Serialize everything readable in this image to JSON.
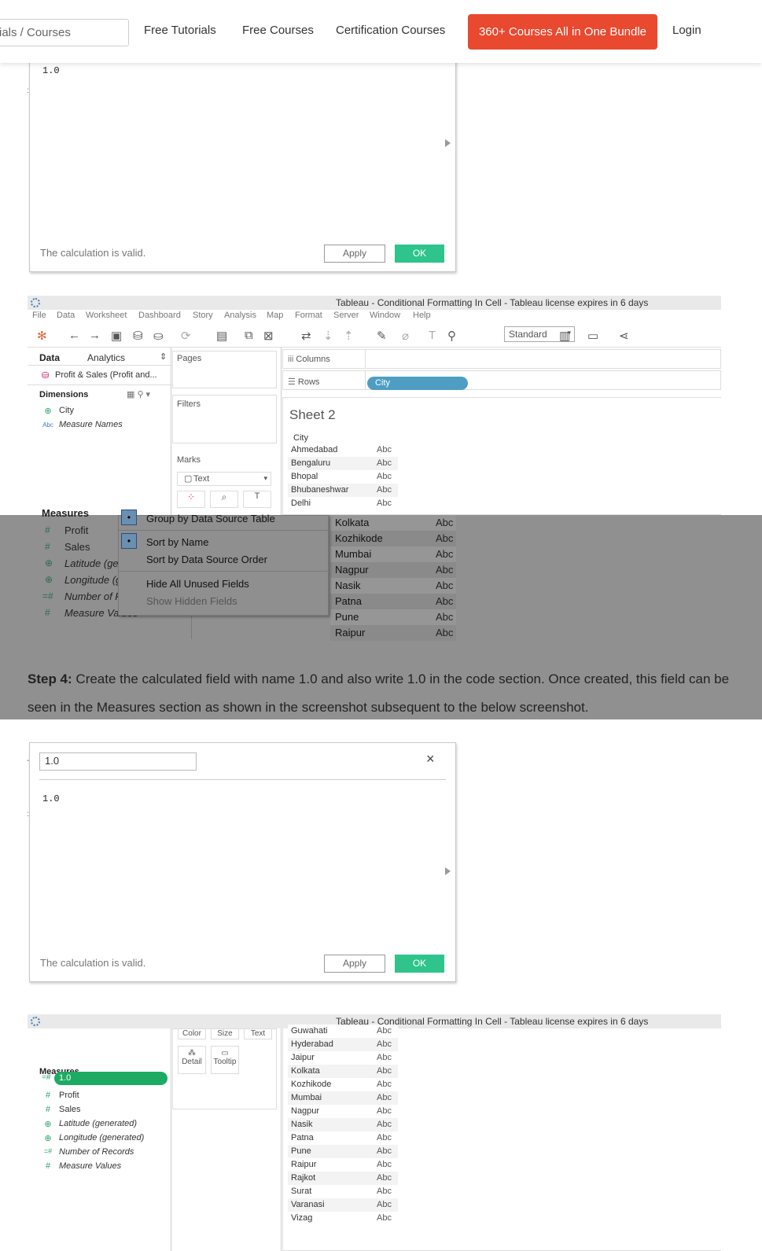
{
  "nav": {
    "search_text": "ials / Courses",
    "links": [
      "Free Tutorials",
      "Free Courses",
      "Certification Courses"
    ],
    "bundle_button": "360+ Courses All in One Bundle",
    "login": "Login"
  },
  "calc_dialog_1": {
    "code": "1.0",
    "status": "The calculation is valid.",
    "apply": "Apply",
    "ok": "OK"
  },
  "tableau_1": {
    "title": "Tableau - Conditional Formatting In Cell - Tableau license expires in 6 days",
    "menu": [
      "File",
      "Data",
      "Worksheet",
      "Dashboard",
      "Story",
      "Analysis",
      "Map",
      "Format",
      "Server",
      "Window",
      "Help"
    ],
    "standard": "Standard",
    "data_tab": "Data",
    "analytics_tab": "Analytics",
    "datasource": "Profit & Sales (Profit and...",
    "dimensions_label": "Dimensions",
    "dimensions": [
      {
        "icon": "globe",
        "name": "City"
      },
      {
        "icon": "abc",
        "name": "Measure Names"
      }
    ],
    "pages_label": "Pages",
    "filters_label": "Filters",
    "marks_label": "Marks",
    "marks_type": "Text",
    "columns_label": "Columns",
    "rows_label": "Rows",
    "rows_pill": "City",
    "sheet_title": "Sheet 2",
    "city_header": "City",
    "cities": [
      "Ahmedabad",
      "Bengaluru",
      "Bhopal",
      "Bhubaneshwar",
      "Delhi"
    ],
    "abc": "Abc"
  },
  "overlay": {
    "measures_label": "Measures",
    "measures": [
      "Profit",
      "Sales",
      "Latitude (ge",
      "Longitude (g",
      "Number of R",
      "Measure Values"
    ],
    "menu_items": [
      {
        "label": "Group by Data Source Table",
        "checked": true
      },
      {
        "label": "Sort by Name",
        "checked": true
      },
      {
        "label": "Sort by Data Source Order",
        "checked": false
      },
      {
        "label": "Hide All Unused Fields",
        "checked": false
      },
      {
        "label": "Show Hidden Fields",
        "checked": false
      }
    ],
    "cities": [
      "Kolkata",
      "Kozhikode",
      "Mumbai",
      "Nagpur",
      "Nasik",
      "Patna",
      "Pune",
      "Raipur"
    ],
    "abc": "Abc"
  },
  "step": {
    "label": "Step 4:",
    "text": " Create the calculated field with name 1.0 and also write 1.0 in the code section. Once created, this field can be seen in the Measures section as shown in the screenshot subsequent to the below screenshot."
  },
  "calc_dialog_2": {
    "name": "1.0",
    "code": "1.0",
    "status": "The calculation is valid.",
    "apply": "Apply",
    "ok": "OK"
  },
  "tableau_2": {
    "title": "Tableau - Conditional Formatting In Cell - Tableau license expires in 6 days",
    "marks_buttons": [
      "Color",
      "Size",
      "Text",
      "Detail",
      "Tooltip"
    ],
    "measures_label": "Measures",
    "measures": [
      {
        "icon": "hash-calc",
        "name": "1.0",
        "italic": false
      },
      {
        "icon": "hash",
        "name": "Profit",
        "italic": false
      },
      {
        "icon": "hash",
        "name": "Sales",
        "italic": false
      },
      {
        "icon": "globe",
        "name": "Latitude (generated)",
        "italic": true
      },
      {
        "icon": "globe",
        "name": "Longitude (generated)",
        "italic": true
      },
      {
        "icon": "hash-calc",
        "name": "Number of Records",
        "italic": true
      },
      {
        "icon": "hash",
        "name": "Measure Values",
        "italic": true
      }
    ],
    "cities": [
      "Guwahati",
      "Hyderabad",
      "Jaipur",
      "Kolkata",
      "Kozhikode",
      "Mumbai",
      "Nagpur",
      "Nasik",
      "Patna",
      "Pune",
      "Raipur",
      "Rajkot",
      "Surat",
      "Varanasi",
      "Vizag"
    ],
    "abc": "Abc"
  }
}
